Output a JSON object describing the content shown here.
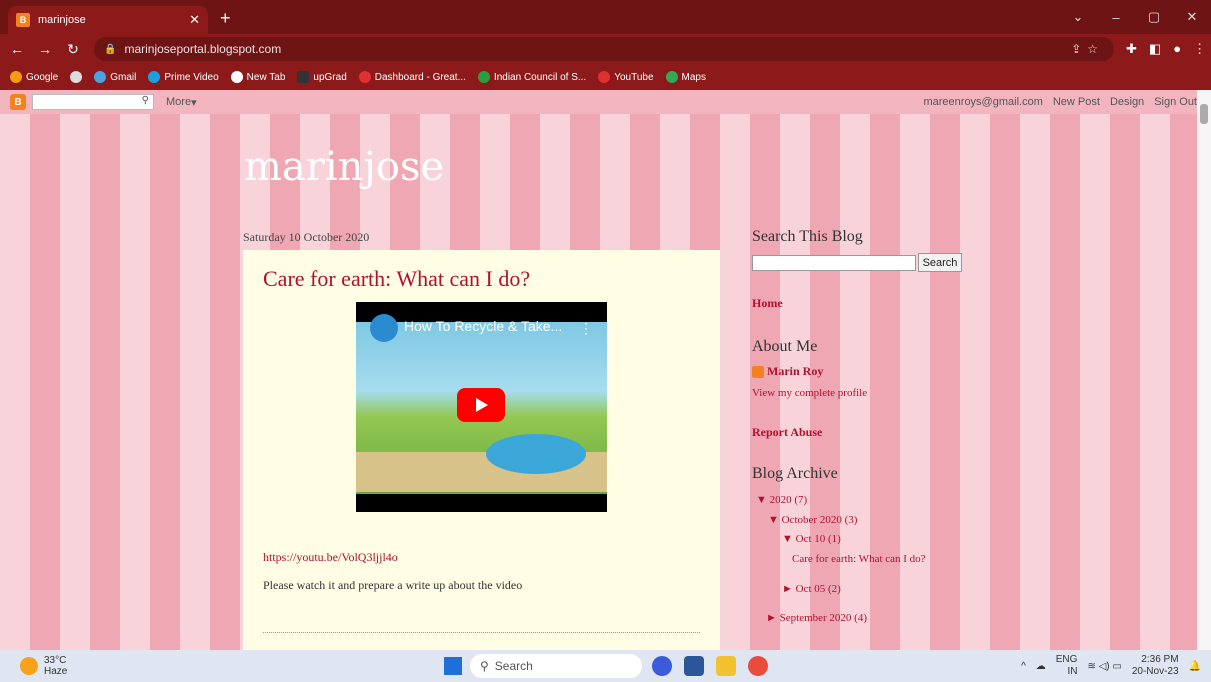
{
  "browser": {
    "tab_title": "marinjose",
    "tab_icon": "blogger-icon",
    "url": "marinjoseportal.blogspot.com",
    "bookmarks": [
      "Google",
      "Gmail",
      "Prime Video",
      "New Tab",
      "upGrad",
      "Dashboard - Great...",
      "Indian Council of S...",
      "YouTube",
      "Maps"
    ]
  },
  "navbar": {
    "more_label": "More",
    "email": "mareenroys@gmail.com",
    "new_post": "New Post",
    "design": "Design",
    "sign_out": "Sign Out"
  },
  "blog": {
    "title": "marinjose",
    "date": "Saturday 10 October 2020",
    "post_title": "Care for earth: What can I do?",
    "video_title": "How To Recycle & Take...",
    "video_link": "https://youtu.be/VolQ3ljjl4o",
    "post_text": "Please watch it and prepare a write up about the video"
  },
  "sidebar": {
    "search_heading": "Search This Blog",
    "search_button": "Search",
    "home": "Home",
    "about_heading": "About Me",
    "author": "Marin Roy",
    "profile_link": "View my complete profile",
    "report": "Report Abuse",
    "archive_heading": "Blog Archive",
    "archive": {
      "year": "2020 (7)",
      "month": "October 2020 (3)",
      "day1": "Oct 10 (1)",
      "post": "Care for earth: What can I do?",
      "day2": "Oct 05 (2)",
      "month2": "September 2020 (4)"
    }
  },
  "taskbar": {
    "temp": "33°C",
    "weather": "Haze",
    "search": "Search",
    "lang1": "ENG",
    "lang2": "IN",
    "time": "2:36 PM",
    "date": "20-Nov-23"
  }
}
